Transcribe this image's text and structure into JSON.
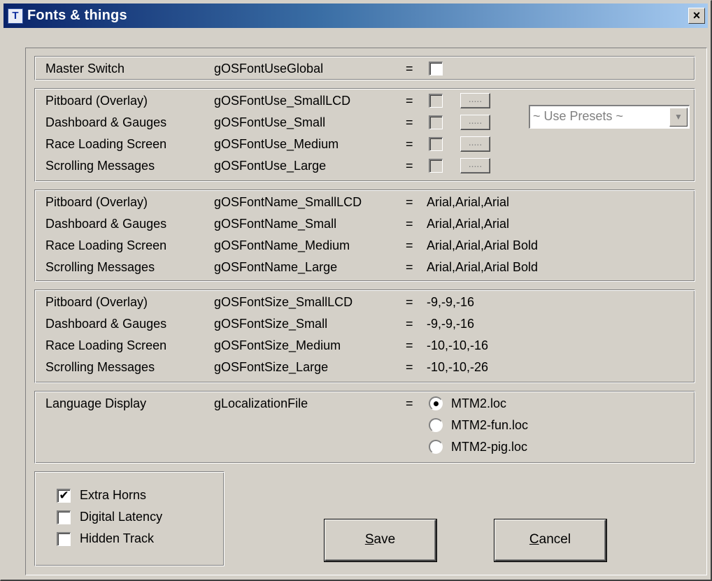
{
  "window": {
    "title": "Fonts & things",
    "icon": "T",
    "close_glyph": "×"
  },
  "master": {
    "label": "Master Switch",
    "var": "gOSFontUseGlobal",
    "eq": "=",
    "checked": false
  },
  "use_group": {
    "rows": [
      {
        "label": "Pitboard (Overlay)",
        "var": "gOSFontUse_SmallLCD",
        "eq": "=",
        "button": "....."
      },
      {
        "label": "Dashboard & Gauges",
        "var": "gOSFontUse_Small",
        "eq": "=",
        "button": "....."
      },
      {
        "label": "Race Loading Screen",
        "var": "gOSFontUse_Medium",
        "eq": "=",
        "button": "....."
      },
      {
        "label": "Scrolling Messages",
        "var": "gOSFontUse_Large",
        "eq": "=",
        "button": "....."
      }
    ],
    "presets": {
      "selected": "~ Use Presets ~",
      "arrow": "▼"
    }
  },
  "name_group": {
    "rows": [
      {
        "label": "Pitboard (Overlay)",
        "var": "gOSFontName_SmallLCD",
        "eq": "=",
        "value": "Arial,Arial,Arial"
      },
      {
        "label": "Dashboard & Gauges",
        "var": "gOSFontName_Small",
        "eq": "=",
        "value": "Arial,Arial,Arial"
      },
      {
        "label": "Race Loading Screen",
        "var": "gOSFontName_Medium",
        "eq": "=",
        "value": "Arial,Arial,Arial Bold"
      },
      {
        "label": "Scrolling Messages",
        "var": "gOSFontName_Large",
        "eq": "=",
        "value": "Arial,Arial,Arial Bold"
      }
    ]
  },
  "size_group": {
    "rows": [
      {
        "label": "Pitboard (Overlay)",
        "var": "gOSFontSize_SmallLCD",
        "eq": "=",
        "value": "-9,-9,-16"
      },
      {
        "label": "Dashboard & Gauges",
        "var": "gOSFontSize_Small",
        "eq": "=",
        "value": "-9,-9,-16"
      },
      {
        "label": "Race Loading Screen",
        "var": "gOSFontSize_Medium",
        "eq": "=",
        "value": "-10,-10,-16"
      },
      {
        "label": "Scrolling Messages",
        "var": "gOSFontSize_Large",
        "eq": "=",
        "value": "-10,-10,-26"
      }
    ]
  },
  "language": {
    "label": "Language Display",
    "var": "gLocalizationFile",
    "eq": "=",
    "options": [
      {
        "label": "MTM2.loc",
        "selected": true
      },
      {
        "label": "MTM2-fun.loc",
        "selected": false
      },
      {
        "label": "MTM2-pig.loc",
        "selected": false
      }
    ]
  },
  "extras": {
    "check_mark": "✔",
    "items": [
      {
        "label": "Extra Horns",
        "checked": true
      },
      {
        "label": "Digital Latency",
        "checked": false
      },
      {
        "label": "Hidden Track",
        "checked": false
      }
    ]
  },
  "buttons": {
    "save": {
      "accel": "S",
      "rest": "ave"
    },
    "cancel": {
      "accel": "C",
      "rest": "ancel"
    }
  }
}
